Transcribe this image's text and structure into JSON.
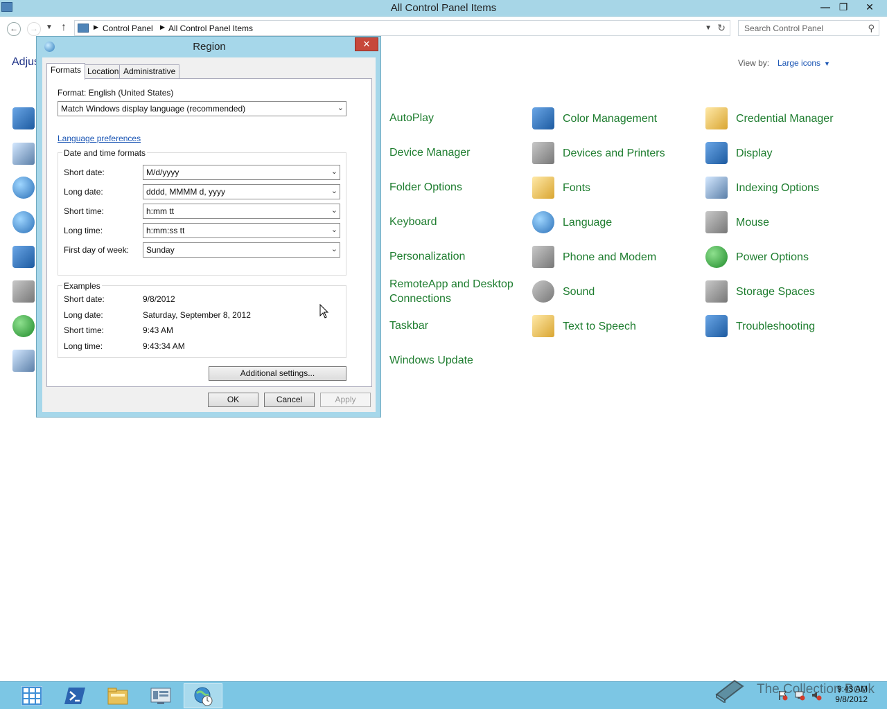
{
  "window": {
    "title": "All Control Panel Items"
  },
  "address": {
    "breadcrumbs": [
      "Control Panel",
      "All Control Panel Items"
    ],
    "search_placeholder": "Search Control Panel"
  },
  "control_panel": {
    "heading_partial": "Adjus",
    "view_by_label": "View by:",
    "view_by_value": "Large icons",
    "items": [
      {
        "label": "AutoPlay",
        "icon": "autoplay-icon"
      },
      {
        "label": "Color Management",
        "icon": "color-management-icon"
      },
      {
        "label": "Credential Manager",
        "icon": "credential-manager-icon"
      },
      {
        "label": "Device Manager",
        "icon": "device-manager-icon"
      },
      {
        "label": "Devices and Printers",
        "icon": "devices-printers-icon"
      },
      {
        "label": "Display",
        "icon": "display-icon"
      },
      {
        "label": "Folder Options",
        "icon": "folder-options-icon"
      },
      {
        "label": "Fonts",
        "icon": "fonts-icon"
      },
      {
        "label": "Indexing Options",
        "icon": "indexing-options-icon"
      },
      {
        "label": "Keyboard",
        "icon": "keyboard-icon"
      },
      {
        "label": "Language",
        "icon": "language-icon"
      },
      {
        "label": "Mouse",
        "icon": "mouse-icon"
      },
      {
        "label": "Personalization",
        "icon": "personalization-icon"
      },
      {
        "label": "Phone and Modem",
        "icon": "phone-modem-icon"
      },
      {
        "label": "Power Options",
        "icon": "power-options-icon"
      },
      {
        "label": "RemoteApp and Desktop Connections",
        "icon": "remoteapp-icon"
      },
      {
        "label": "Sound",
        "icon": "sound-icon"
      },
      {
        "label": "Storage Spaces",
        "icon": "storage-spaces-icon"
      },
      {
        "label": "Taskbar",
        "icon": "taskbar-icon"
      },
      {
        "label": "Text to Speech",
        "icon": "text-to-speech-icon"
      },
      {
        "label": "Troubleshooting",
        "icon": "troubleshooting-icon"
      },
      {
        "label": "Windows Update",
        "icon": "windows-update-icon"
      }
    ]
  },
  "dialog": {
    "title": "Region",
    "tabs": [
      "Formats",
      "Location",
      "Administrative"
    ],
    "active_tab": "Formats",
    "format_label": "Format: English (United States)",
    "format_value": "Match Windows display language (recommended)",
    "language_link": "Language preferences",
    "date_time_group": "Date and time formats",
    "fields": [
      {
        "label": "Short date:",
        "value": "M/d/yyyy"
      },
      {
        "label": "Long date:",
        "value": "dddd, MMMM d, yyyy"
      },
      {
        "label": "Short time:",
        "value": "h:mm tt"
      },
      {
        "label": "Long time:",
        "value": "h:mm:ss tt"
      },
      {
        "label": "First day of week:",
        "value": "Sunday"
      }
    ],
    "examples_group": "Examples",
    "examples": [
      {
        "label": "Short date:",
        "value": "9/8/2012"
      },
      {
        "label": "Long date:",
        "value": "Saturday, September 8, 2012"
      },
      {
        "label": "Short time:",
        "value": "9:43 AM"
      },
      {
        "label": "Long time:",
        "value": "9:43:34 AM"
      }
    ],
    "additional_settings": "Additional settings...",
    "ok": "OK",
    "cancel": "Cancel",
    "apply": "Apply"
  },
  "taskbar": {
    "time": "9:43 AM",
    "date": "9/8/2012",
    "watermark": "The Collection Book"
  },
  "colors": {
    "titlebar": "#a7d6e7",
    "taskbar": "#7cc6e4",
    "item_link": "#1e7d2f",
    "link_blue": "#1a55b4",
    "close_red": "#c7483b"
  }
}
